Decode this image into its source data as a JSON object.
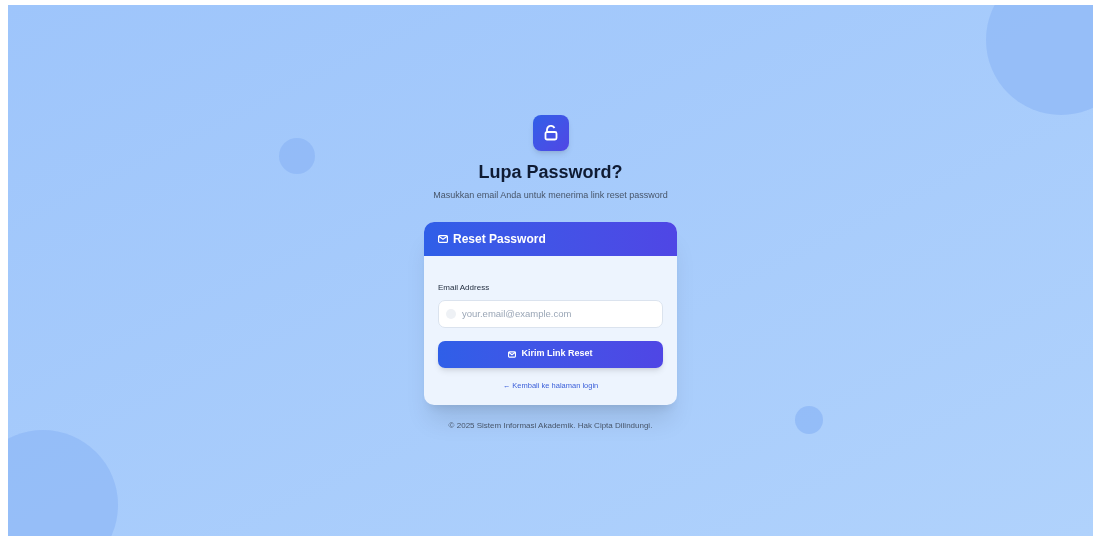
{
  "header": {
    "title": "Lupa Password?",
    "subtitle": "Masukkan email Anda untuk menerima link reset password"
  },
  "card": {
    "title": "Reset Password",
    "email_field": {
      "label": "Email Address",
      "placeholder": "your.email@example.com"
    },
    "submit_button": "Kirim Link Reset",
    "back_link": "← Kembali ke halaman login"
  },
  "footer": "© 2025 Sistem Informasi Akademik. Hak Cipta Dilindungi."
}
